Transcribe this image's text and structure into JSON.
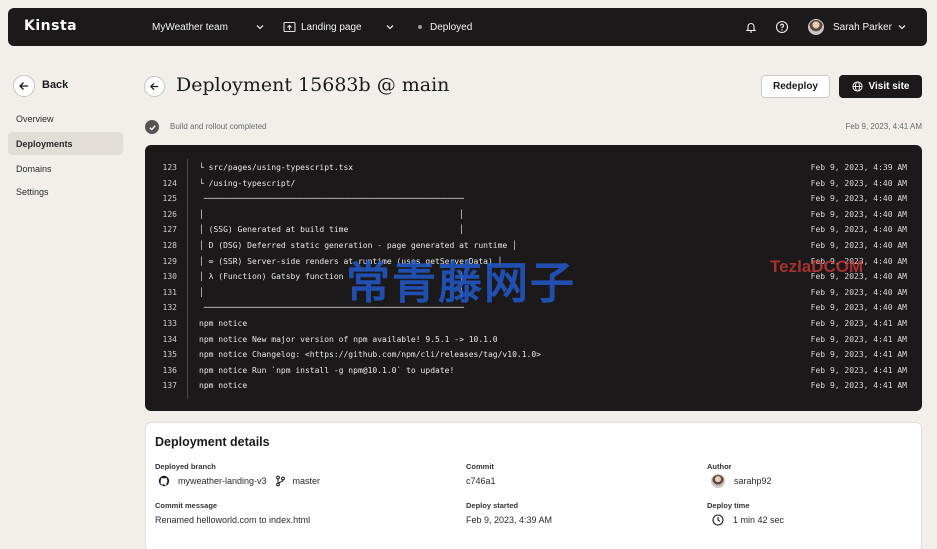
{
  "topbar": {
    "logo": "Kinsta",
    "team": "MyWeather team",
    "site": "Landing page",
    "status": "Deployed",
    "user_name": "Sarah Parker"
  },
  "sidebar": {
    "back_label": "Back",
    "items": [
      {
        "label": "Overview",
        "active": false
      },
      {
        "label": "Deployments",
        "active": true
      },
      {
        "label": "Domains",
        "active": false
      },
      {
        "label": "Settings",
        "active": false
      }
    ]
  },
  "header": {
    "title": "Deployment 15683b @ main",
    "redeploy_label": "Redeploy",
    "visit_label": "Visit site"
  },
  "status": {
    "text": "Build and rollout completed",
    "date": "Feb 9, 2023, 4:41 AM"
  },
  "log": [
    {
      "line": "123",
      "text": "└ src/pages/using-typescript.tsx",
      "time": "Feb 9, 2023, 4:39 AM"
    },
    {
      "line": "124",
      "text": "└ /using-typescript/",
      "time": "Feb 9, 2023, 4:40 AM"
    },
    {
      "line": "125",
      "text": " ──────────────────────────────────────────────────────",
      "time": "Feb 9, 2023, 4:40 AM"
    },
    {
      "line": "126",
      "text": "│                                                     │",
      "time": "Feb 9, 2023, 4:40 AM"
    },
    {
      "line": "127",
      "text": "│ (SSG) Generated at build time                       │",
      "time": "Feb 9, 2023, 4:40 AM"
    },
    {
      "line": "128",
      "text": "│ D (DSG) Deferred static generation - page generated at runtime │",
      "time": "Feb 9, 2023, 4:40 AM"
    },
    {
      "line": "129",
      "text": "│ ∞ (SSR) Server-side renders at runtime (uses getServerData) │",
      "time": "Feb 9, 2023, 4:40 AM"
    },
    {
      "line": "130",
      "text": "│ λ (Function) Gatsby function                        │",
      "time": "Feb 9, 2023, 4:40 AM"
    },
    {
      "line": "131",
      "text": "│                                                     │",
      "time": "Feb 9, 2023, 4:40 AM"
    },
    {
      "line": "132",
      "text": " ──────────────────────────────────────────────────────",
      "time": "Feb 9, 2023, 4:40 AM"
    },
    {
      "line": "133",
      "text": "npm notice",
      "time": "Feb 9, 2023, 4:41 AM"
    },
    {
      "line": "134",
      "text": "npm notice New major version of npm available! 9.5.1 -> 10.1.0",
      "time": "Feb 9, 2023, 4:41 AM"
    },
    {
      "line": "135",
      "text": "npm notice Changelog: <https://github.com/npm/cli/releases/tag/v10.1.0>",
      "time": "Feb 9, 2023, 4:41 AM"
    },
    {
      "line": "136",
      "text": "npm notice Run `npm install -g npm@10.1.0` to update!",
      "time": "Feb 9, 2023, 4:41 AM"
    },
    {
      "line": "137",
      "text": "npm notice",
      "time": "Feb 9, 2023, 4:41 AM"
    }
  ],
  "watermark": {
    "main": "常青藤网子",
    "side": "TezlaDCOM"
  },
  "details": {
    "title": "Deployment details",
    "branch_label": "Deployed branch",
    "repo": "myweather-landing-v3",
    "branch": "master",
    "commit_label": "Commit",
    "commit": "c746a1",
    "author_label": "Author",
    "author": "sarahp92",
    "message_label": "Commit message",
    "message": "Renamed helloworld.com to index.html",
    "started_label": "Deploy started",
    "started": "Feb 9, 2023, 4:39 AM",
    "duration_label": "Deploy time",
    "duration": "1 min 42 sec"
  }
}
